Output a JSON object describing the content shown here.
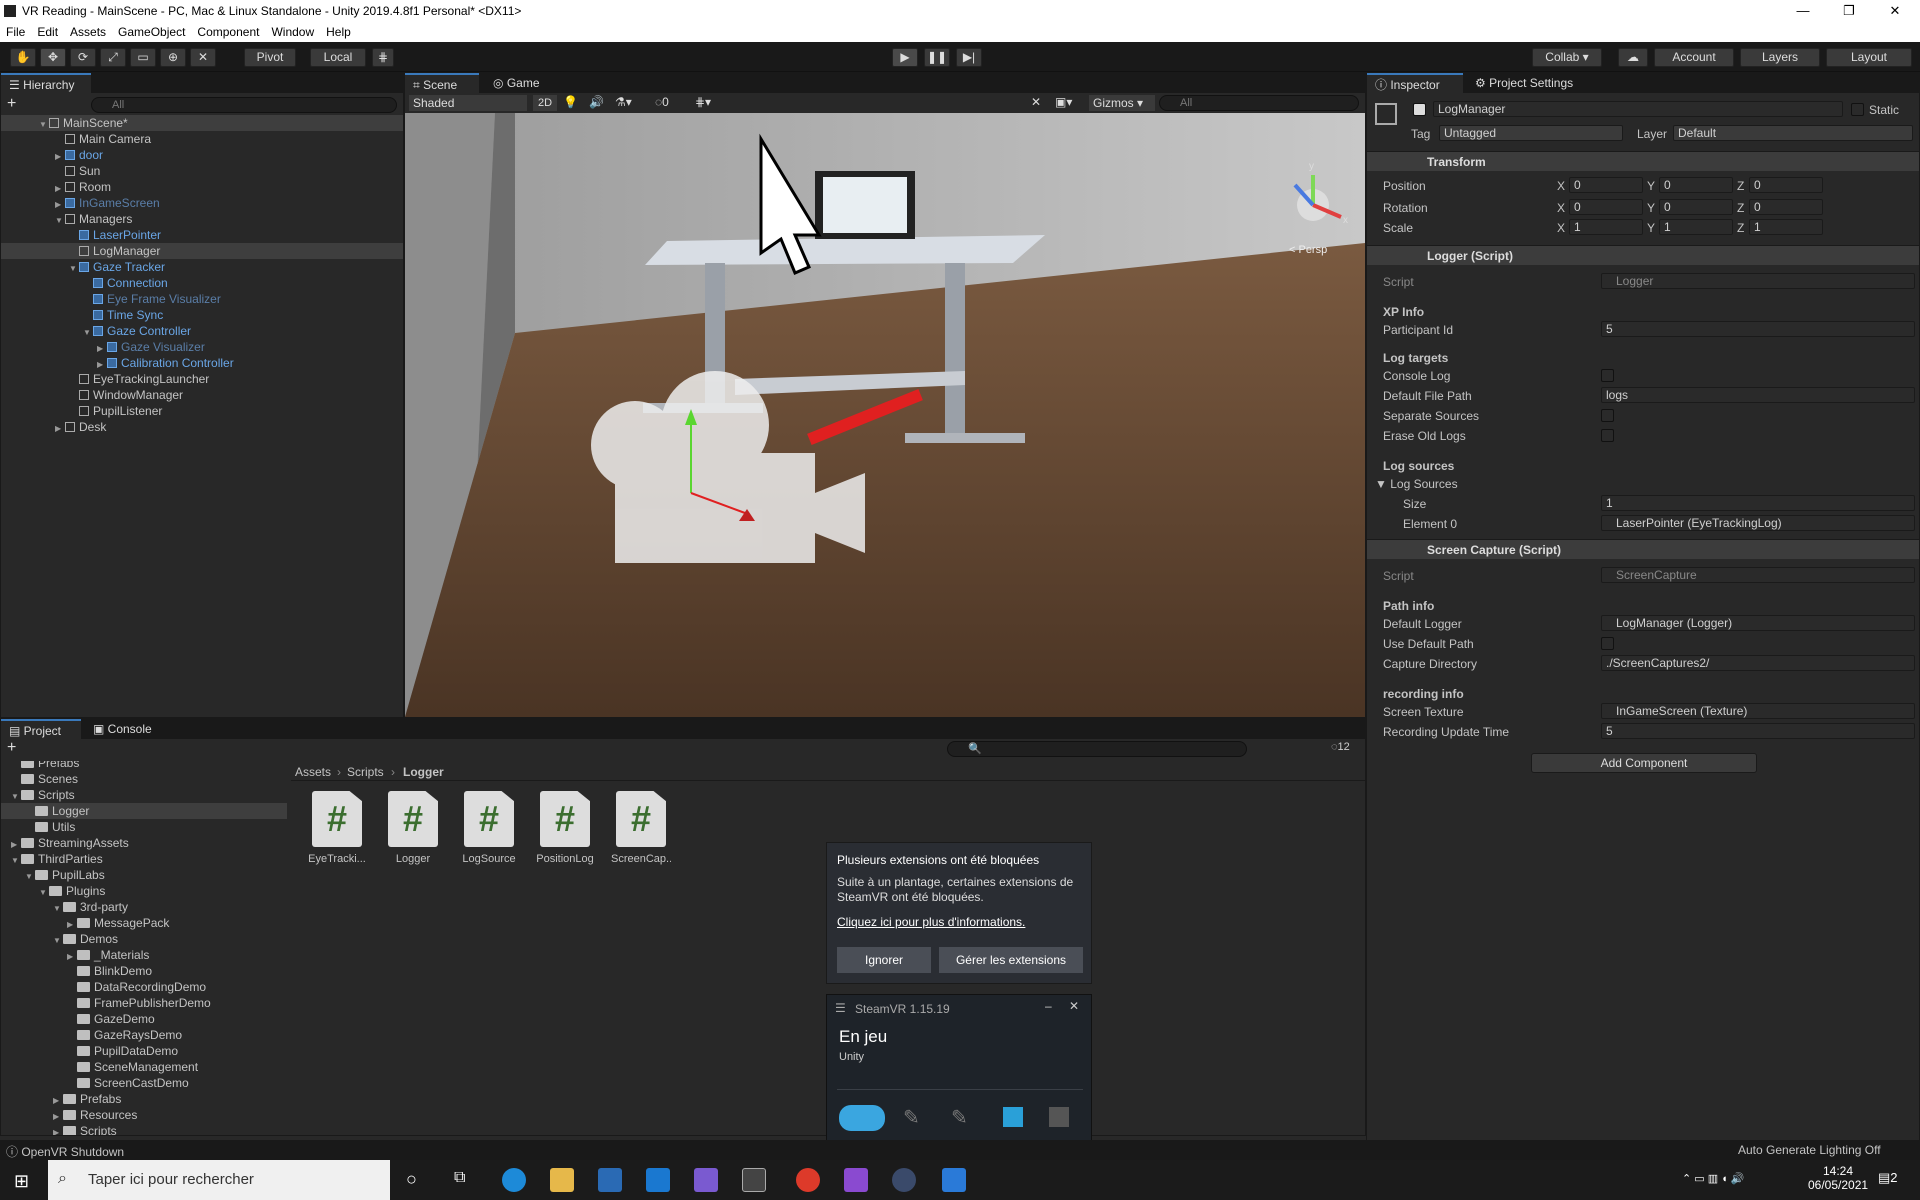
{
  "window": {
    "title": "VR Reading - MainScene - PC, Mac & Linux Standalone - Unity 2019.4.8f1 Personal* <DX11>"
  },
  "menu": [
    "File",
    "Edit",
    "Assets",
    "GameObject",
    "Component",
    "Window",
    "Help"
  ],
  "toolbar": {
    "pivot": "Pivot",
    "local": "Local",
    "collab": "Collab ▾",
    "account": "Account",
    "layers": "Layers",
    "layout": "Layout"
  },
  "hierarchy": {
    "title": "Hierarchy",
    "search_placeholder": "All",
    "scene": "MainScene*",
    "items": [
      {
        "label": "Main Camera",
        "indent": 1,
        "style": "normal"
      },
      {
        "label": "door",
        "indent": 1,
        "style": "blue",
        "arrow": "▶"
      },
      {
        "label": "Sun",
        "indent": 1,
        "style": "normal"
      },
      {
        "label": "Room",
        "indent": 1,
        "style": "normal",
        "arrow": "▶"
      },
      {
        "label": "InGameScreen",
        "indent": 1,
        "style": "dim",
        "arrow": "▶"
      },
      {
        "label": "Managers",
        "indent": 1,
        "style": "normal",
        "arrow": "▼"
      },
      {
        "label": "LaserPointer",
        "indent": 2,
        "style": "blue"
      },
      {
        "label": "LogManager",
        "indent": 2,
        "style": "normal",
        "sel": true
      },
      {
        "label": "Gaze Tracker",
        "indent": 2,
        "style": "blue",
        "arrow": "▼"
      },
      {
        "label": "Connection",
        "indent": 3,
        "style": "blue"
      },
      {
        "label": "Eye Frame Visualizer",
        "indent": 3,
        "style": "dim"
      },
      {
        "label": "Time Sync",
        "indent": 3,
        "style": "blue"
      },
      {
        "label": "Gaze Controller",
        "indent": 3,
        "style": "blue",
        "arrow": "▼"
      },
      {
        "label": "Gaze Visualizer",
        "indent": 4,
        "style": "dim",
        "arrow": "▶"
      },
      {
        "label": "Calibration Controller",
        "indent": 4,
        "style": "blue",
        "arrow": "▶"
      },
      {
        "label": "EyeTrackingLauncher",
        "indent": 2,
        "style": "normal"
      },
      {
        "label": "WindowManager",
        "indent": 2,
        "style": "normal"
      },
      {
        "label": "PupilListener",
        "indent": 2,
        "style": "normal"
      },
      {
        "label": "Desk",
        "indent": 1,
        "style": "normal",
        "arrow": "▶"
      }
    ]
  },
  "scene": {
    "tab_scene": "Scene",
    "tab_game": "Game",
    "shading": "Shaded",
    "mode2d": "2D",
    "gizmos": "Gizmos",
    "search_placeholder": "All",
    "persp": "< Persp",
    "hidden_count": "0"
  },
  "inspector": {
    "tab_inspector": "Inspector",
    "tab_settings": "Project Settings",
    "object_name": "LogManager",
    "static_label": "Static",
    "tag_label": "Tag",
    "tag_value": "Untagged",
    "layer_label": "Layer",
    "layer_value": "Default",
    "transform": {
      "title": "Transform",
      "position": "Position",
      "rotation": "Rotation",
      "scale": "Scale",
      "pos": [
        "0",
        "0",
        "0"
      ],
      "rot": [
        "0",
        "0",
        "0"
      ],
      "scl": [
        "1",
        "1",
        "1"
      ]
    },
    "logger": {
      "title": "Logger (Script)",
      "script_label": "Script",
      "script_value": "Logger",
      "xp_info": "XP Info",
      "participant_label": "Participant Id",
      "participant_value": "5",
      "log_targets": "Log targets",
      "console_log": "Console Log",
      "default_path_label": "Default File Path",
      "default_path_value": "logs",
      "separate_sources": "Separate Sources",
      "erase_old": "Erase Old Logs",
      "log_sources_h": "Log sources",
      "log_sources": "Log Sources",
      "size_label": "Size",
      "size_value": "1",
      "element0_label": "Element 0",
      "element0_value": "LaserPointer (EyeTrackingLog)"
    },
    "capture": {
      "title": "Screen Capture (Script)",
      "script_label": "Script",
      "script_value": "ScreenCapture",
      "path_info": "Path info",
      "default_logger_label": "Default Logger",
      "default_logger_value": "LogManager (Logger)",
      "use_default": "Use Default Path",
      "capture_dir_label": "Capture Directory",
      "capture_dir_value": "./ScreenCaptures2/",
      "recording_info": "recording info",
      "screen_tex_label": "Screen Texture",
      "screen_tex_value": "InGameScreen (Texture)",
      "update_label": "Recording Update Time",
      "update_value": "5"
    },
    "add_component": "Add Component"
  },
  "project": {
    "tab_project": "Project",
    "tab_console": "Console",
    "hidden_count": "12",
    "breadcrumb": [
      "Assets",
      "Scripts",
      "Logger"
    ],
    "tree": [
      {
        "label": "Prefabs",
        "indent": 1
      },
      {
        "label": "Scenes",
        "indent": 1
      },
      {
        "label": "Scripts",
        "indent": 1,
        "arrow": "▼"
      },
      {
        "label": "Logger",
        "indent": 2,
        "sel": true
      },
      {
        "label": "Utils",
        "indent": 2
      },
      {
        "label": "StreamingAssets",
        "indent": 1,
        "arrow": "▶"
      },
      {
        "label": "ThirdParties",
        "indent": 1,
        "arrow": "▼"
      },
      {
        "label": "PupilLabs",
        "indent": 2,
        "arrow": "▼"
      },
      {
        "label": "Plugins",
        "indent": 3,
        "arrow": "▼"
      },
      {
        "label": "3rd-party",
        "indent": 4,
        "arrow": "▼"
      },
      {
        "label": "MessagePack",
        "indent": 5,
        "arrow": "▶"
      },
      {
        "label": "Demos",
        "indent": 4,
        "arrow": "▼"
      },
      {
        "label": "_Materials",
        "indent": 5,
        "arrow": "▶"
      },
      {
        "label": "BlinkDemo",
        "indent": 5
      },
      {
        "label": "DataRecordingDemo",
        "indent": 5
      },
      {
        "label": "FramePublisherDemo",
        "indent": 5
      },
      {
        "label": "GazeDemo",
        "indent": 5
      },
      {
        "label": "GazeRaysDemo",
        "indent": 5
      },
      {
        "label": "PupilDataDemo",
        "indent": 5
      },
      {
        "label": "SceneManagement",
        "indent": 5
      },
      {
        "label": "ScreenCastDemo",
        "indent": 5
      },
      {
        "label": "Prefabs",
        "indent": 4,
        "arrow": "▶"
      },
      {
        "label": "Resources",
        "indent": 4,
        "arrow": "▶"
      },
      {
        "label": "Scripts",
        "indent": 4,
        "arrow": "▶"
      }
    ],
    "assets": [
      "EyeTracki...",
      "Logger",
      "LogSource",
      "PositionLog",
      "ScreenCap..."
    ]
  },
  "steamvr_notice": {
    "title": "Plusieurs extensions ont été bloquées",
    "body": "Suite à un plantage, certaines extensions de SteamVR ont été bloquées.",
    "link": "Cliquez ici pour plus d'informations.",
    "ignore": "Ignorer",
    "manage": "Gérer les extensions"
  },
  "steamvr": {
    "title": "SteamVR 1.15.19",
    "status": "En jeu",
    "app": "Unity"
  },
  "statusbar": {
    "left": "OpenVR Shutdown",
    "right": "Auto Generate Lighting Off"
  },
  "taskbar": {
    "search": "Taper ici pour rechercher",
    "time": "14:24",
    "date": "06/05/2021",
    "notif": "2"
  },
  "colors": {
    "accent": "#2c5d87",
    "prefab_blue": "#6aa6e6",
    "panel": "#282828"
  }
}
